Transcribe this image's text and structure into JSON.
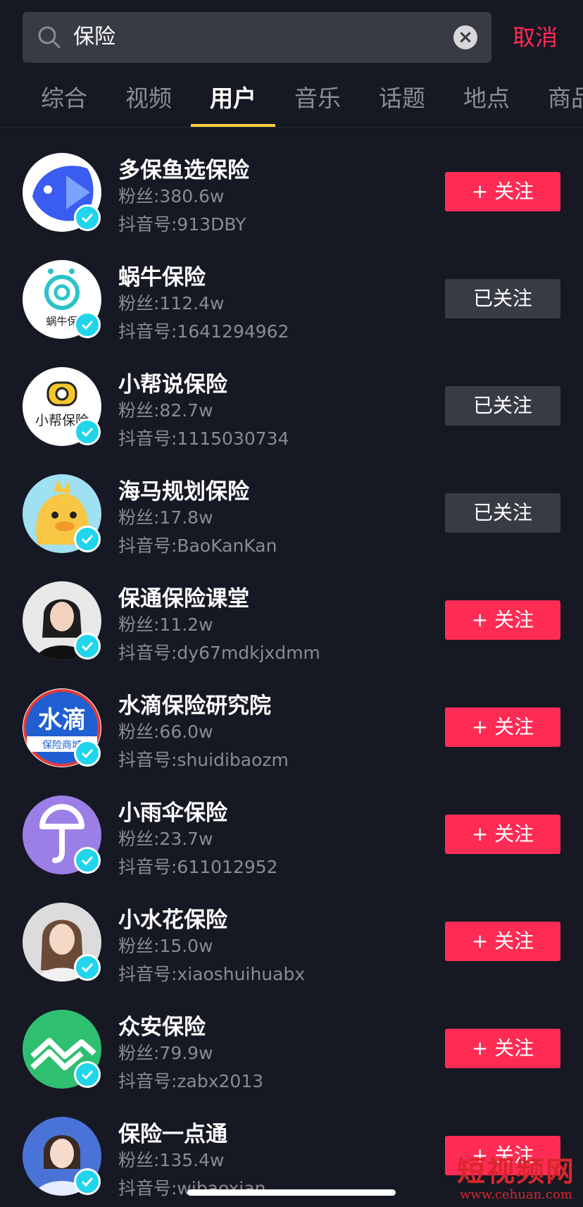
{
  "search": {
    "query": "保险",
    "cancel_label": "取消"
  },
  "tabs": [
    "综合",
    "视频",
    "用户",
    "音乐",
    "话题",
    "地点",
    "商品"
  ],
  "active_tab": "用户",
  "users": [
    {
      "name": "多保鱼选保险",
      "fans": "粉丝:380.6w",
      "dyid": "抖音号:913DBY",
      "button": "+ 关注",
      "followed": false
    },
    {
      "name": "蜗牛保险",
      "fans": "粉丝:112.4w",
      "dyid": "抖音号:1641294962",
      "button": "已关注",
      "followed": true,
      "avatar_text": "蜗牛保"
    },
    {
      "name": "小帮说保险",
      "fans": "粉丝:82.7w",
      "dyid": "抖音号:1115030734",
      "button": "已关注",
      "followed": true,
      "avatar_text": "小帮保险"
    },
    {
      "name": "海马规划保险",
      "fans": "粉丝:17.8w",
      "dyid": "抖音号:BaoKanKan",
      "button": "已关注",
      "followed": true
    },
    {
      "name": "保通保险课堂",
      "fans": "粉丝:11.2w",
      "dyid": "抖音号:dy67mdkjxdmm",
      "button": "+ 关注",
      "followed": false
    },
    {
      "name": "水滴保险研究院",
      "fans": "粉丝:66.0w",
      "dyid": "抖音号:shuidibaozm",
      "button": "+ 关注",
      "followed": false,
      "avatar_text": "水滴",
      "avatar_subtext": "保险商城"
    },
    {
      "name": "小雨伞保险",
      "fans": "粉丝:23.7w",
      "dyid": "抖音号:611012952",
      "button": "+ 关注",
      "followed": false
    },
    {
      "name": "小水花保险",
      "fans": "粉丝:15.0w",
      "dyid": "抖音号:xiaoshuihuabx",
      "button": "+ 关注",
      "followed": false
    },
    {
      "name": "众安保险",
      "fans": "粉丝:79.9w",
      "dyid": "抖音号:zabx2013",
      "button": "+ 关注",
      "followed": false
    },
    {
      "name": "保险一点通",
      "fans": "粉丝:135.4w",
      "dyid": "抖音号:wibaoxian",
      "button": "+ 关注",
      "followed": false
    }
  ],
  "watermark": {
    "main": "短视频网",
    "sub": "www.cehuan.com"
  },
  "colors": {
    "background": "#161823",
    "accent": "#fe2c55",
    "tab_indicator": "#facd3f",
    "verified": "#20d5ec"
  }
}
